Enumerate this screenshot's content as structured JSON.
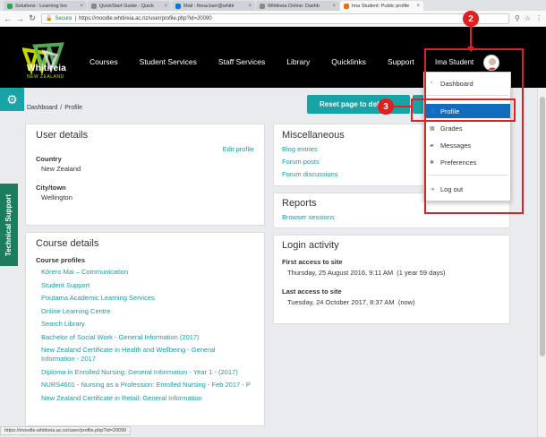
{
  "browser": {
    "tabs": [
      {
        "title": "Solutions : Learning Ieo",
        "color": "#2ea44f"
      },
      {
        "title": "QuickStart Guide - Quick",
        "color": "#888888"
      },
      {
        "title": "Mail - fiona.barr@whitir",
        "color": "#0078d4"
      },
      {
        "title": "Whitireia Online: Dashb",
        "color": "#888888"
      },
      {
        "title": "Ima Student: Public profile",
        "color": "#e8710a"
      }
    ],
    "secure_label": "Secure",
    "url": "https://moodle.whitireia.ac.nz/user/profile.php?id=20090"
  },
  "header": {
    "logo_text": "Whitireia",
    "logo_sub": "NEW ZEALAND",
    "nav": [
      "Courses",
      "Student Services",
      "Staff Services",
      "Library",
      "Quicklinks",
      "Support"
    ],
    "user_name": "Ima Student"
  },
  "breadcrumb": [
    "Dashboard",
    "Profile"
  ],
  "reset_button": "Reset page to default",
  "side_tab": "Technical Support",
  "user_details": {
    "title": "User details",
    "edit_link": "Edit profile",
    "country_label": "Country",
    "country_value": "New Zealand",
    "city_label": "City/town",
    "city_value": "Wellington"
  },
  "course_details": {
    "title": "Course details",
    "profiles_label": "Course profiles",
    "courses": [
      "Kōrero Mai – Communication",
      "Student Support",
      "Poutama Academic Learning Services",
      "Online Learning Centre",
      "Search Library",
      "Bachelor of Social Work - General Information (2017)",
      "New Zealand Certificate in Health and Wellbeing - General Information - 2017",
      "Diploma in Enrolled Nursing: General Information - Year 1 - (2017)",
      "NURS4601 - Nursing as a Profession: Enrolled Nursing - Feb 2017 - P",
      "New Zealand Certificate in Retail: General Information"
    ]
  },
  "misc": {
    "title": "Miscellaneous",
    "links": [
      "Blog entries",
      "Forum posts",
      "Forum discussions"
    ]
  },
  "reports": {
    "title": "Reports",
    "links": [
      "Browser sessions"
    ]
  },
  "login": {
    "title": "Login activity",
    "first_label": "First access to site",
    "first_value": "Thursday, 25 August 2016, 9:11 AM  (1 year 59 days)",
    "last_label": "Last access to site",
    "last_value": "Tuesday, 24 October 2017, 8:37 AM  (now)"
  },
  "user_menu": {
    "items": [
      "Dashboard",
      "Profile",
      "Grades",
      "Messages",
      "Preferences",
      "Log out"
    ]
  },
  "annotations": {
    "marker_a": "2",
    "marker_b": "3"
  },
  "status_url": "https://moodle.whitireia.ac.nz/user/profile.php?id=20090",
  "colors": {
    "teal": "#18a3a7",
    "active_menu": "#0f6cbf",
    "annotation": "#e02020",
    "support_tab": "#1b7d5e"
  }
}
